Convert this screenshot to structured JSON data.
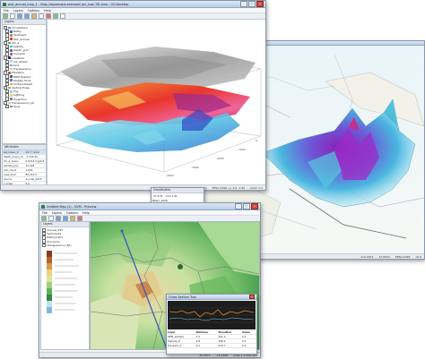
{
  "window_main": {
    "title": "plot_annual_map_1 - http://aquamaps.example/ gis_hub/ 3D view - GV-Desktop",
    "menu": [
      "File",
      "Layers",
      "Options",
      "Help"
    ],
    "statusbar": [
      "-121.8833, 49.2010",
      "EPSG:4326 +/- 4.0, 1.45",
      "zoom 1:1"
    ],
    "scene_axis_labels": [
      "-4000",
      "-3000",
      "-2000",
      "-1000",
      "0"
    ]
  },
  "layers_tree": {
    "title": "Layers",
    "items": [
      {
        "label": "Annotations",
        "color": "#7a8aa0"
      },
      {
        "label": "Bathy",
        "color": "#3d6fc4"
      },
      {
        "label": "Sediment",
        "color": "#c98a3e"
      },
      {
        "label": "SST_Annual",
        "color": "#d9472e"
      },
      {
        "label": "Chl_a",
        "color": "#3ea84a"
      },
      {
        "label": "Salinity",
        "color": "#4fb3c9"
      },
      {
        "label": "Depth_grid",
        "color": "#6d6d6d"
      },
      {
        "label": "Currents",
        "color": "#8d5fc9"
      },
      {
        "label": "Coastline",
        "color": "#2c2c2c"
      },
      {
        "label": "Ice_extent",
        "color": "#a9d8ee"
      },
      {
        "label": "Grid",
        "color": "#9b9b9b"
      },
      {
        "label": "Transparency",
        "color": "#c0c0c0"
      },
      {
        "label": "Elevation",
        "color": "#8a6a3c"
      },
      {
        "label": "DEM Shaded",
        "color": "#5c5c5c"
      },
      {
        "label": "Display Tools",
        "color": "#4a7bd0"
      },
      {
        "label": "Surface Relief",
        "color": "#d2a14a"
      },
      {
        "label": "Vertical Exag.",
        "color": "#7fb070"
      },
      {
        "label": "Fog",
        "color": "#b8c4d2"
      },
      {
        "label": "Lighting",
        "color": "#e8d06b"
      },
      {
        "label": "Projection",
        "color": "#6688aa"
      },
      {
        "label": "Transparency (2)",
        "color": "#c0c0c0"
      },
      {
        "label": "Tools",
        "color": "#888888"
      }
    ]
  },
  "attributes_panel": {
    "title": "Attributes",
    "rows": [
      [
        "sst_mean_C",
        "12.7 / 12.9"
      ],
      [
        "depth_mean_m",
        "-1,254.20"
      ],
      [
        "chl_a_mean",
        "0.8214 mg/m3"
      ],
      [
        "salinity_psu",
        "33.418"
      ],
      [
        "cell_count",
        "1,024"
      ],
      [
        "area_km2",
        "85,214.5"
      ],
      [
        "source",
        "annual_2015"
      ],
      [
        "z_scale",
        "5.0"
      ]
    ]
  },
  "window_terrain": {
    "statusbar": [
      "-112.4971",
      "47.6055",
      "EPSG:4326",
      "x5.0"
    ]
  },
  "window_map": {
    "title": "Untitled Map (1) - GVM - Preview",
    "menu": [
      "File",
      "Layers",
      "Options",
      "Help"
    ],
    "legend_title": "Layers",
    "legend_items": [
      "Annual_SST",
      "Sediments",
      "Bathymetry",
      "Provinces",
      "Transparency (40)"
    ],
    "statusbar": [
      "32.4571",
      "-15.2288",
      "scale 1:2,500,000"
    ]
  },
  "info_panel": {
    "title": "Coordinates",
    "values": [
      "37.9 N",
      "-112.4 W"
    ],
    "rows": [
      "Beam_1026",
      "Beam_2048",
      "Beam_DSR_v",
      "Sample_04"
    ]
  },
  "profile_window": {
    "title": "Cross Section Tool",
    "headers": [
      "Layer",
      "Distance",
      "Elevation",
      "Value"
    ],
    "rows": [
      [
        "DEM_sample",
        "1.2",
        "541.0",
        "0.2"
      ],
      [
        "Sample_E",
        "2.8",
        "498.4",
        "0.5"
      ],
      [
        "Transect_3",
        "4.1",
        "612.7",
        "0.3"
      ]
    ]
  }
}
